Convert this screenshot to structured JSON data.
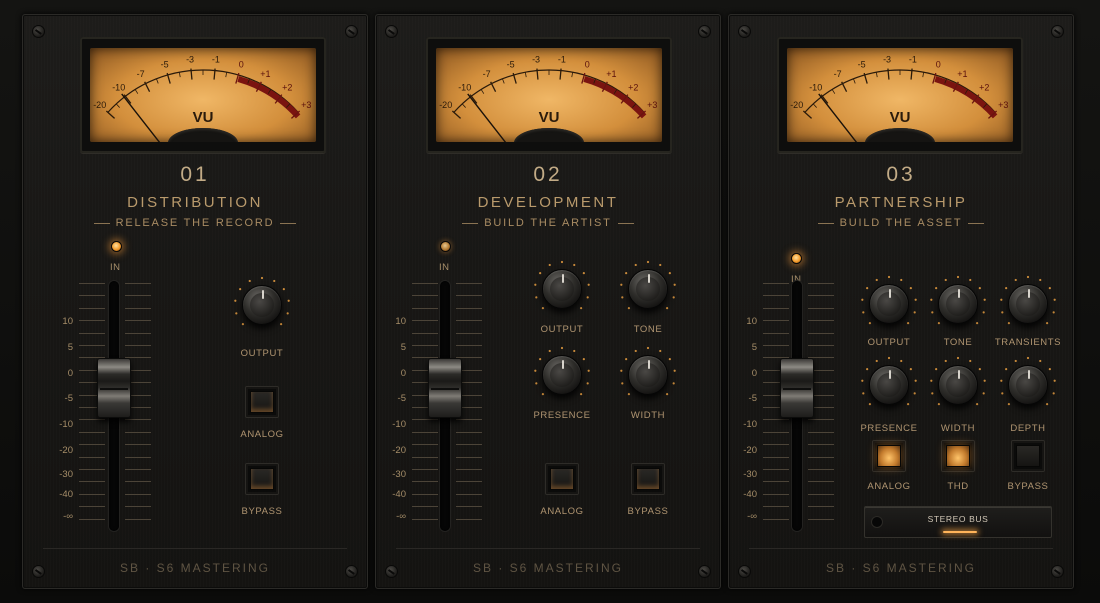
{
  "colors": {
    "accent": "#f39a2a",
    "text": "#b59a72",
    "meter_face": "#e5a550",
    "panel": "#1a1917"
  },
  "meter": {
    "scale": [
      "-20",
      "-10",
      "-7",
      "-5",
      "-3",
      "-1",
      "0",
      "+1",
      "+2",
      "+3"
    ],
    "label": "VU"
  },
  "fader_scale": [
    "10",
    "5",
    "0",
    "-5",
    "-10",
    "-20",
    "-30",
    "-40",
    "-∞"
  ],
  "panels": [
    {
      "number": "01",
      "title": "DISTRIBUTION",
      "subtitle": "RELEASE THE RECORD",
      "in_label": "IN",
      "brand": "SB · S6 MASTERING",
      "knobs": [
        {
          "label": "OUTPUT"
        }
      ],
      "buttons": [
        {
          "label": "ANALOG"
        },
        {
          "label": "BYPASS"
        }
      ]
    },
    {
      "number": "02",
      "title": "DEVELOPMENT",
      "subtitle": "BUILD THE ARTIST",
      "in_label": "IN",
      "brand": "SB · S6 MASTERING",
      "knobs": [
        {
          "label": "OUTPUT"
        },
        {
          "label": "TONE"
        },
        {
          "label": "PRESENCE"
        },
        {
          "label": "WIDTH"
        }
      ],
      "buttons": [
        {
          "label": "ANALOG"
        },
        {
          "label": "BYPASS"
        }
      ]
    },
    {
      "number": "03",
      "title": "PARTNERSHIP",
      "subtitle": "BUILD THE ASSET",
      "in_label": "IN",
      "brand": "SB · S6 MASTERING",
      "knobs": [
        {
          "label": "OUTPUT"
        },
        {
          "label": "TONE"
        },
        {
          "label": "TRANSIENTS"
        },
        {
          "label": "PRESENCE"
        },
        {
          "label": "WIDTH"
        },
        {
          "label": "DEPTH"
        }
      ],
      "buttons": [
        {
          "label": "ANALOG"
        },
        {
          "label": "THD"
        },
        {
          "label": "BYPASS"
        }
      ],
      "stereo_bus": "STEREO BUS"
    }
  ]
}
